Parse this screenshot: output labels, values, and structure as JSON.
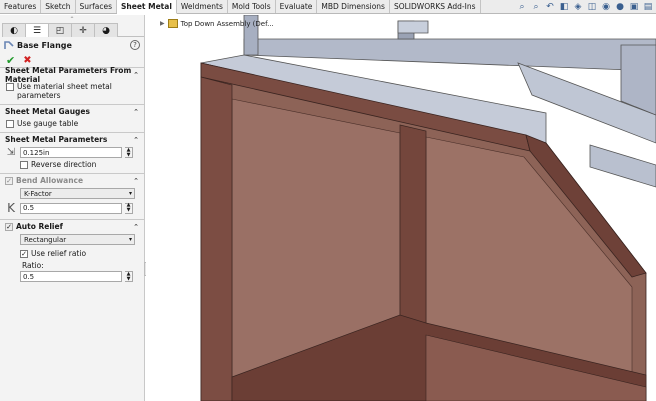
{
  "tabs": [
    "Features",
    "Sketch",
    "Surfaces",
    "Sheet Metal",
    "Weldments",
    "Mold Tools",
    "Evaluate",
    "MBD Dimensions",
    "SOLIDWORKS Add-Ins"
  ],
  "active_tab": "Sheet Metal",
  "feature": {
    "title": "Base Flange"
  },
  "groups": {
    "material": {
      "title": "Sheet Metal Parameters From Material",
      "checkbox": "Use material sheet metal parameters"
    },
    "gauges": {
      "title": "Sheet Metal Gauges",
      "checkbox": "Use gauge table"
    },
    "parameters": {
      "title": "Sheet Metal Parameters",
      "thickness": "0.125in",
      "reverse": "Reverse direction"
    },
    "bend": {
      "title": "Bend Allowance",
      "type": "K-Factor",
      "k_symbol": "K",
      "k_value": "0.5"
    },
    "relief": {
      "title": "Auto Relief",
      "type": "Rectangular",
      "use_ratio": "Use relief ratio",
      "ratio_label": "Ratio:",
      "ratio_value": "0.5"
    }
  },
  "viewport": {
    "tree_label": "Top Down Assembly (Def..."
  },
  "colors": {
    "panel_face": "#8b5f55",
    "edge_face": "#6f4238",
    "frame": "#b8bfd0",
    "frame_dark": "#6a7080"
  }
}
